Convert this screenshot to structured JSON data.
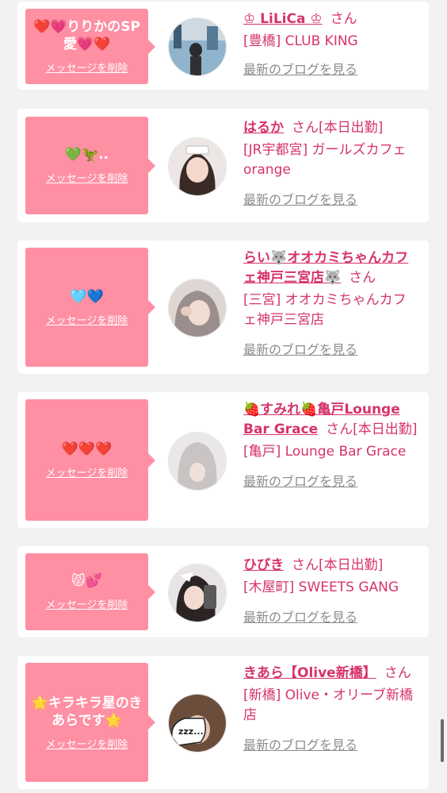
{
  "delete_label": "メッセージを削除",
  "blog_label": "最新のブログを見る",
  "san_label": "さん",
  "colors": {
    "accent": "#d6336c",
    "bubble": "#ff8fa3",
    "muted": "#8c8c8c",
    "background": "#f2f2f2"
  },
  "entries": [
    {
      "message": "❤️💗りりかのSP愛💗❤️",
      "name": "♔ LiLiCa ♔",
      "status": "",
      "shop": "[豊橋] CLUB KING"
    },
    {
      "message": "💚🦖..",
      "name": "はるか",
      "status": "[本日出勤]",
      "shop": "[JR宇都宮] ガールズカフェ orange"
    },
    {
      "message": "🩵💙",
      "name": "らい🐺オオカミちゃんカフェ神戸三宮店🐺",
      "status": "",
      "shop": "[三宮] オオカミちゃんカフェ神戸三宮店"
    },
    {
      "message": "❤️❤️❤️",
      "name": "🍓すみれ🍓亀戸Lounge Bar Grace",
      "status": "[本日出勤]",
      "shop": "[亀戸] Lounge Bar Grace"
    },
    {
      "message": "😾💕",
      "name": "ひびき",
      "status": "[本日出勤]",
      "shop": "[木屋町] SWEETS GANG"
    },
    {
      "message": "🌟キラキラ星のきあらです🌟",
      "name": "きあら【Olive新橋】",
      "status": "",
      "shop": "[新橋] Olive・オリーブ新橋店"
    }
  ]
}
